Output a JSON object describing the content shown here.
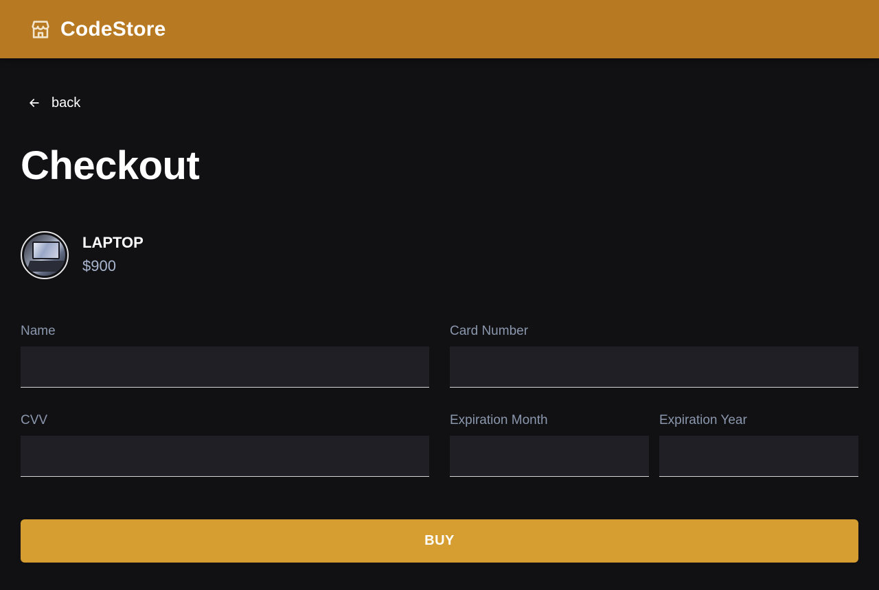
{
  "header": {
    "brand": "CodeStore",
    "logo_icon": "store-icon",
    "background": "#b77a22"
  },
  "nav": {
    "back_label": "back",
    "back_icon": "arrow-left-icon"
  },
  "page": {
    "title": "Checkout"
  },
  "product": {
    "name": "LAPTOP",
    "price": "$900",
    "image_icon": "laptop-photo"
  },
  "form": {
    "name": {
      "label": "Name",
      "value": ""
    },
    "card_number": {
      "label": "Card Number",
      "value": ""
    },
    "cvv": {
      "label": "CVV",
      "value": ""
    },
    "exp_month": {
      "label": "Expiration Month",
      "value": ""
    },
    "exp_year": {
      "label": "Expiration Year",
      "value": ""
    }
  },
  "actions": {
    "buy_label": "BUY",
    "buy_color": "#d69d30"
  }
}
